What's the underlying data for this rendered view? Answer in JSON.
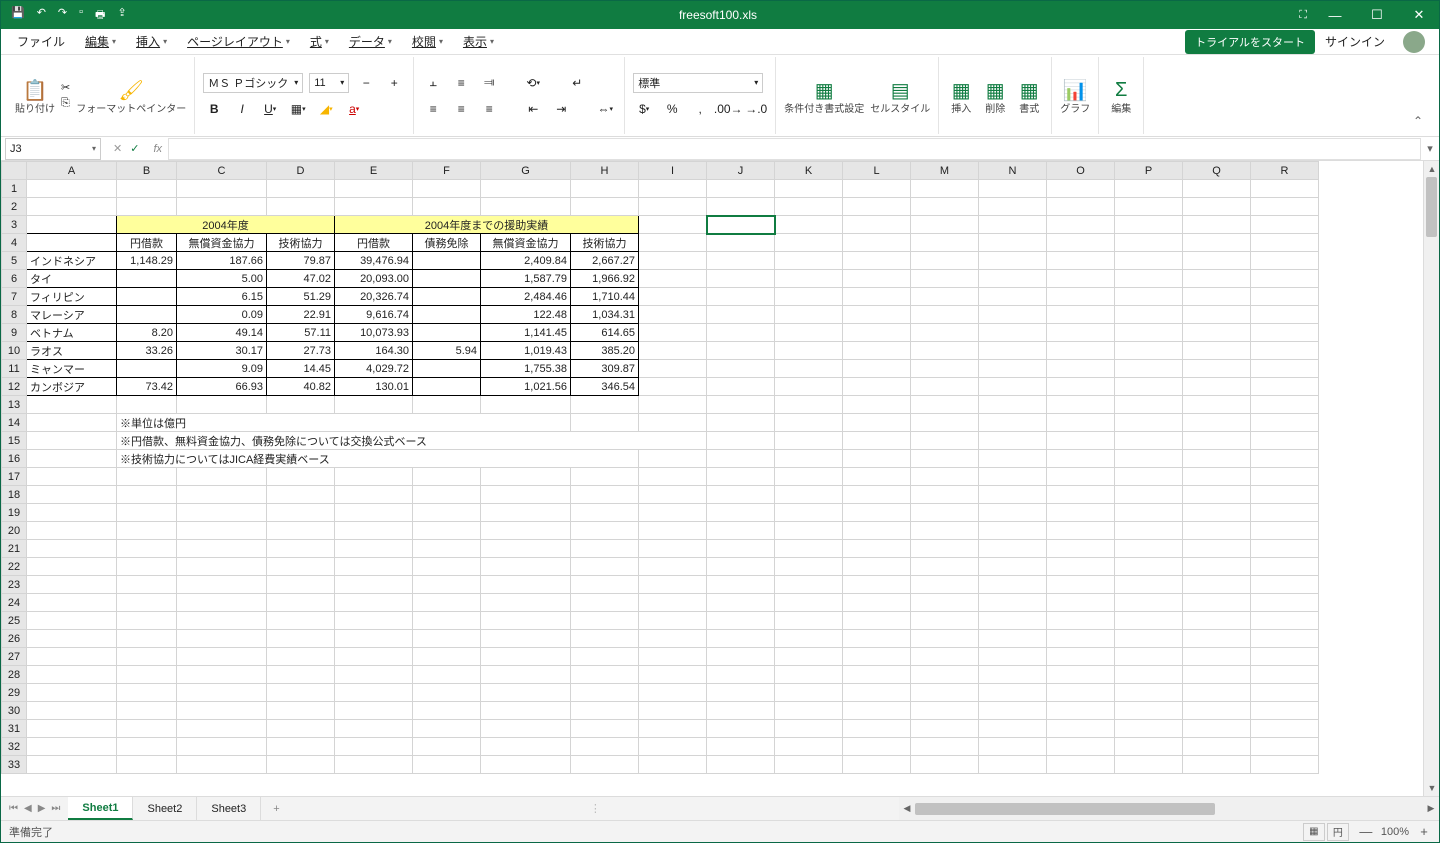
{
  "title": "freesoft100.xls",
  "menu": {
    "file": "ファイル",
    "edit": "編集",
    "insert": "挿入",
    "layout": "ページレイアウト",
    "formula": "式",
    "data": "データ",
    "review": "校閲",
    "view": "表示"
  },
  "trial": "トライアルをスタート",
  "signin": "サインイン",
  "ribbon": {
    "paste": "貼り付け",
    "painter": "フォーマットペインター",
    "font": "ＭＳ Ｐゴシック",
    "size": "11",
    "style": "標準",
    "condfmt": "条件付き書式設定",
    "cellstyle": "セルスタイル",
    "ins": "挿入",
    "del": "削除",
    "fmt": "書式",
    "chart": "グラフ",
    "editg": "編集"
  },
  "namebox": "J3",
  "fx": "fx",
  "cols": [
    "A",
    "B",
    "C",
    "D",
    "E",
    "F",
    "G",
    "H",
    "I",
    "J",
    "K",
    "L",
    "M",
    "N",
    "O",
    "P",
    "Q",
    "R"
  ],
  "headers": {
    "g1": "2004年度",
    "g2": "2004年度までの援助実績",
    "c1": "円借款",
    "c2": "無償資金協力",
    "c3": "技術協力",
    "c4": "円借款",
    "c5": "債務免除",
    "c6": "無償資金協力",
    "c7": "技術協力"
  },
  "rows": [
    {
      "n": "インドネシア",
      "b": "1,148.29",
      "c": "187.66",
      "d": "79.87",
      "e": "39,476.94",
      "f": "",
      "g": "2,409.84",
      "h": "2,667.27"
    },
    {
      "n": "タイ",
      "b": "",
      "c": "5.00",
      "d": "47.02",
      "e": "20,093.00",
      "f": "",
      "g": "1,587.79",
      "h": "1,966.92"
    },
    {
      "n": "フィリピン",
      "b": "",
      "c": "6.15",
      "d": "51.29",
      "e": "20,326.74",
      "f": "",
      "g": "2,484.46",
      "h": "1,710.44"
    },
    {
      "n": "マレーシア",
      "b": "",
      "c": "0.09",
      "d": "22.91",
      "e": "9,616.74",
      "f": "",
      "g": "122.48",
      "h": "1,034.31"
    },
    {
      "n": "ベトナム",
      "b": "8.20",
      "c": "49.14",
      "d": "57.11",
      "e": "10,073.93",
      "f": "",
      "g": "1,141.45",
      "h": "614.65"
    },
    {
      "n": "ラオス",
      "b": "33.26",
      "c": "30.17",
      "d": "27.73",
      "e": "164.30",
      "f": "5.94",
      "g": "1,019.43",
      "h": "385.20"
    },
    {
      "n": "ミャンマー",
      "b": "",
      "c": "9.09",
      "d": "14.45",
      "e": "4,029.72",
      "f": "",
      "g": "1,755.38",
      "h": "309.87"
    },
    {
      "n": "カンボジア",
      "b": "73.42",
      "c": "66.93",
      "d": "40.82",
      "e": "130.01",
      "f": "",
      "g": "1,021.56",
      "h": "346.54"
    }
  ],
  "notes": {
    "n1": "※単位は億円",
    "n2": "※円借款、無料資金協力、債務免除については交換公式ベース",
    "n3": "※技術協力についてはJICA経費実績ベース"
  },
  "sheets": {
    "s1": "Sheet1",
    "s2": "Sheet2",
    "s3": "Sheet3"
  },
  "status": "準備完了",
  "zoom": "100%",
  "currency": "円"
}
